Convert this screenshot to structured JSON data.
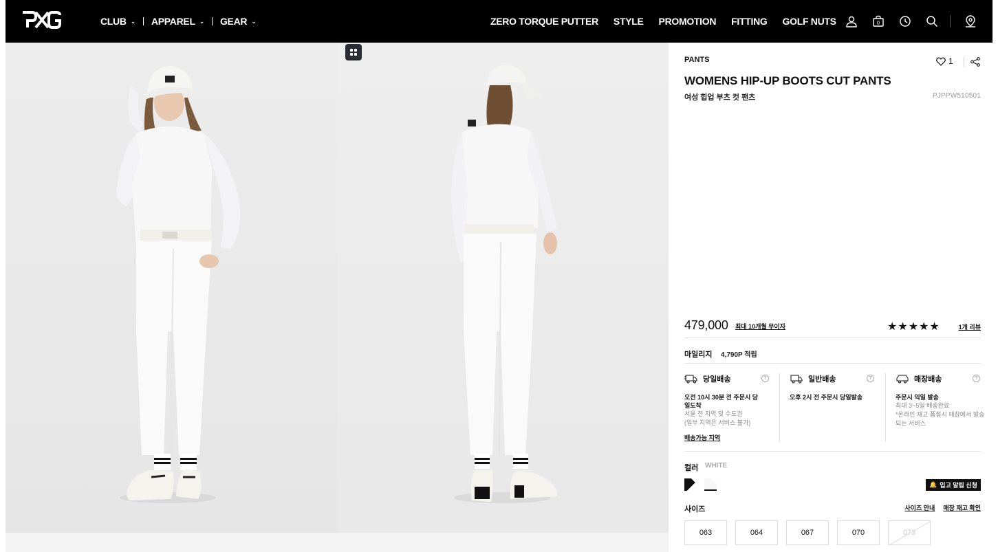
{
  "header": {
    "logo_text": "PXG",
    "main_nav": [
      {
        "label": "CLUB"
      },
      {
        "label": "APPAREL"
      },
      {
        "label": "GEAR"
      }
    ],
    "links": [
      "ZERO TORQUE PUTTER",
      "STYLE",
      "PROMOTION",
      "FITTING",
      "GOLF NUTS"
    ],
    "icons": [
      "user-icon",
      "shopping-bag-icon",
      "history-clock-icon",
      "search-icon",
      "store-location-icon"
    ]
  },
  "product": {
    "category": "PANTS",
    "title": "WOMENS HIP-UP BOOTS CUT PANTS",
    "subtitle": "여성 힙업 부츠 컷 팬츠",
    "code": "PJPPW510501",
    "likes": "1",
    "price": "479,000",
    "installment": "최대 10개월 무이자",
    "rating_stars": "★★★★★",
    "rating": 5,
    "review_link": "1개 리뷰",
    "mileage_label": "마일리지",
    "mileage_value": "4,790P 적립"
  },
  "shipping": [
    {
      "title": "당일배송",
      "main": "오전 10시 30분 전 주문시 당일도착",
      "notes": [
        "서울 전 지역 및 수도권",
        "(일부 지역은 서비스 불가)"
      ],
      "link": "배송가능 지역"
    },
    {
      "title": "일반배송",
      "main": "오후 2시 전 주문시 당일발송",
      "notes": [],
      "link": ""
    },
    {
      "title": "매장배송",
      "main": "주문시 익일 발송",
      "notes": [
        "최대 3~5일 배송완료",
        "*온라인 재고 품절시 매장에서 발송되는 서비스"
      ],
      "link": ""
    }
  ],
  "options": {
    "color_label": "컬러",
    "color_selected": "WHITE",
    "swatches": [
      {
        "name": "black",
        "hex": "#111111"
      },
      {
        "name": "white",
        "hex": "#f7f7f7"
      }
    ],
    "restock_button": "입고 알림 신청",
    "size_label": "사이즈",
    "size_guide": "사이즈 안내",
    "store_stock": "매장 재고 확인",
    "sizes": [
      {
        "label": "063",
        "soldout": false
      },
      {
        "label": "064",
        "soldout": false
      },
      {
        "label": "067",
        "soldout": false
      },
      {
        "label": "070",
        "soldout": false
      },
      {
        "label": "073",
        "soldout": true
      }
    ]
  },
  "colors": {
    "header_bg": "#000000",
    "accent": "#111111",
    "muted": "#999999"
  }
}
